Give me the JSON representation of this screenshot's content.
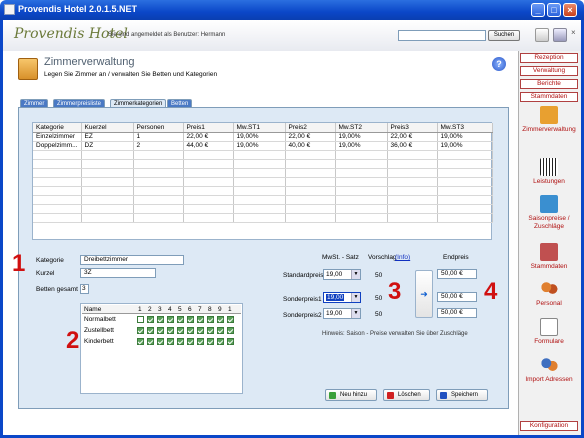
{
  "window": {
    "title": "Provendis Hotel 2.0.1.5.NET"
  },
  "header": {
    "logo": "Provendis Hotel",
    "logged_in": "Sie sind angemeldet als Benutzer: Hermann",
    "search_button": "Suchen",
    "search_value": ""
  },
  "right_nav": {
    "buttons": [
      "Rezeption",
      "Verwaltung",
      "Berichte",
      "Stammdaten"
    ],
    "items": [
      {
        "label": "Zimmerverwaltung",
        "icon": "clipboard-icon",
        "color": "#e8a030"
      },
      {
        "label": "Leistungen",
        "icon": "barcode-icon",
        "color": "#555555"
      },
      {
        "label": "Saisonpreise / Zuschläge",
        "icon": "calculator-icon",
        "color": "#3a8fd0"
      },
      {
        "label": "Stammdaten",
        "icon": "edit-icon",
        "color": "#c05050"
      },
      {
        "label": "Personal",
        "icon": "users-icon",
        "color": "#e08030"
      },
      {
        "label": "Formulare",
        "icon": "document-icon",
        "color": "#eeeeee"
      },
      {
        "label": "Import Adressen",
        "icon": "import-users-icon",
        "color": "#4070c0"
      }
    ],
    "config": "Konfiguration"
  },
  "page": {
    "title": "Zimmerverwaltung",
    "subtitle": "Legen Sie Zimmer an / verwalten Sie Betten und Kategorien"
  },
  "tabs": [
    {
      "label": "Zimmer",
      "active": false
    },
    {
      "label": "Zimmerpreisliste",
      "active": false
    },
    {
      "label": "Zimmerkategorien",
      "active": true
    },
    {
      "label": "Betten",
      "active": false
    }
  ],
  "table": {
    "columns": [
      "Kategorie",
      "Kuerzel",
      "Personen",
      "Preis1",
      "Mw.ST1",
      "Preis2",
      "Mw.ST2",
      "Preis3",
      "Mw.ST3"
    ],
    "rows": [
      [
        "Einzelzimmer",
        "EZ",
        "1",
        "22,00 €",
        "19,00%",
        "22,00 €",
        "19,00%",
        "22,00 €",
        "19,00%"
      ],
      [
        "Doppelzimm...",
        "DZ",
        "2",
        "44,00 €",
        "19,00%",
        "40,00 €",
        "19,00%",
        "36,00 €",
        "19,00%"
      ]
    ]
  },
  "form": {
    "kategorie_label": "Kategorie",
    "kategorie_value": "Dreibettzimmer",
    "kuerzel_label": "Kurzel",
    "kuerzel_value": "3Z",
    "betten_label": "Betten gesamt",
    "betten_value": "3"
  },
  "bed_grid": {
    "header_name": "Name",
    "columns": [
      "1",
      "2",
      "3",
      "4",
      "5",
      "6",
      "7",
      "8",
      "9",
      "1"
    ],
    "rows": [
      {
        "name": "Normalbett",
        "checked": [
          false,
          true,
          true,
          true,
          true,
          true,
          true,
          true,
          true,
          true
        ]
      },
      {
        "name": "Zustellbett",
        "checked": [
          true,
          true,
          true,
          true,
          true,
          true,
          true,
          true,
          true,
          true
        ]
      },
      {
        "name": "Kinderbett",
        "checked": [
          true,
          true,
          true,
          true,
          true,
          true,
          true,
          true,
          true,
          true
        ]
      }
    ]
  },
  "pricing": {
    "mwst_header": "MwSt. - Satz",
    "vorschlag_header": "Vorschlag",
    "info_link": "(Info)",
    "endpreis_header": "Endpreis",
    "rows": [
      {
        "label": "Standardpreis",
        "mwst": "19,00",
        "vorschlag": "50",
        "endpreis": "50,00 €"
      },
      {
        "label": "Sonderpreis1",
        "mwst": "19,00",
        "vorschlag": "50",
        "endpreis": "50,00 €"
      },
      {
        "label": "Sonderpreis2",
        "mwst": "19,00",
        "vorschlag": "50",
        "endpreis": "50,00 €"
      }
    ],
    "hint": "Hinweis: Saison - Preise verwalten Sie über Zuschläge"
  },
  "annotations": [
    "1",
    "2",
    "3",
    "4"
  ],
  "buttons": {
    "add": "Neu hinzu",
    "delete": "Löschen",
    "save": "Speichern"
  },
  "colors": {
    "accent": "#b01010",
    "titlebar": "#0b47c8",
    "panel": "#dde9f5"
  }
}
